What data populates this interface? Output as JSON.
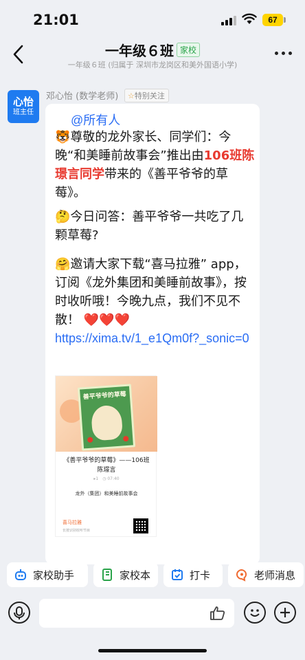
{
  "status_bar": {
    "time": "21:01",
    "battery": "67"
  },
  "nav": {
    "title": "一年级６班",
    "tag": "家校",
    "subtitle": "一年级６班 (归属于 深圳市龙岗区和美外国语小学)"
  },
  "message": {
    "avatar_name": "心怡",
    "avatar_role": "班主任",
    "sender": "邓心怡 (数学老师)",
    "follow_label": "特别关注",
    "mention": "@所有人",
    "p1_emoji": "🐯",
    "p1_a": "尊敬的龙外家长、同学们：今晚“和美睡前故事会”推出由",
    "p1_red": "106班陈璟言同学",
    "p1_b": "带来的《善平爷爷的草莓》。",
    "p2_emoji": "🤔",
    "p2_text": "今日问答：善平爷爷一共吃了几颗草莓?",
    "p3_emoji": "🤗",
    "p3_text": "邀请大家下载“喜马拉雅” app，订阅《龙外集团和美睡前故事》，按时收听哦！今晚九点，我们不见不散！",
    "p3_hearts": "❤️❤️❤️",
    "link": "https://xima.tv/1_e1Qm0f?_sonic=0",
    "poster": {
      "cover_title": "善平爷爷的草莓",
      "title": "《善平爷爷的草莓》——106班　陈璟言",
      "meta": "▸1　◷ 07:40",
      "org": "龙外（集团）和美睡前故事会",
      "logo": "喜马拉雅",
      "logo_sub": "长按识别收听节目"
    }
  },
  "quick_actions": [
    {
      "label": "家校助手",
      "color": "#1f7bf0"
    },
    {
      "label": "家校本",
      "color": "#2aa34a"
    },
    {
      "label": "打卡",
      "color": "#1f7bf0"
    },
    {
      "label": "老师消息",
      "color": "#f06a30"
    }
  ],
  "input": {
    "placeholder": ""
  }
}
